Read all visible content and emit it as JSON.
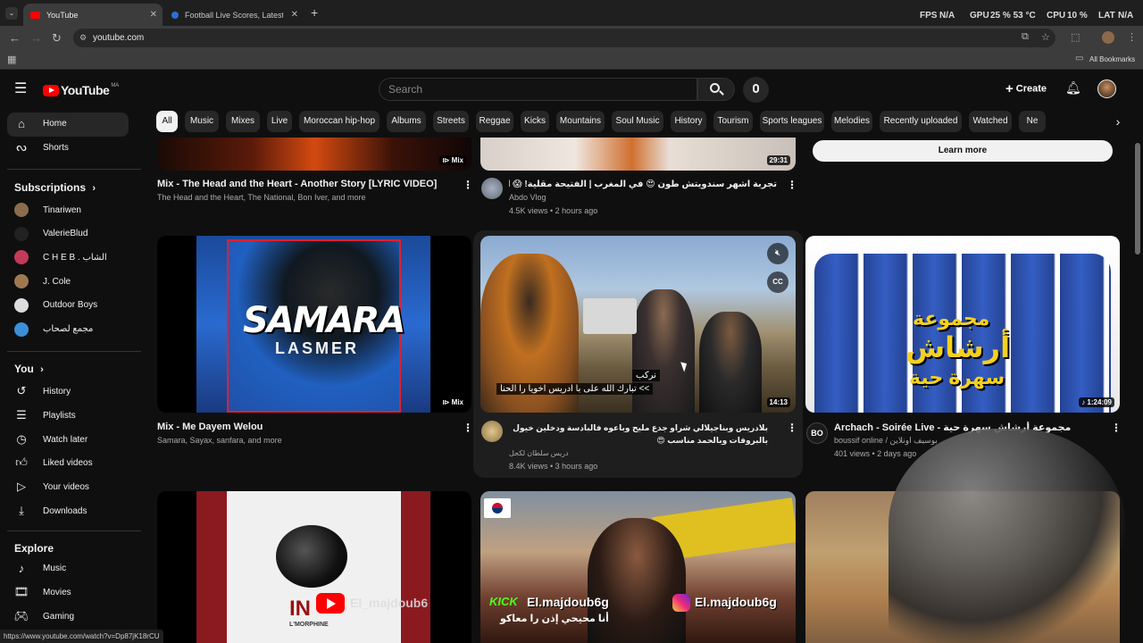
{
  "browser": {
    "tabs": [
      {
        "title": "YouTube"
      },
      {
        "title": "Football Live Scores, Latest Foo"
      }
    ],
    "new_tab": "+",
    "perf": {
      "fps_label": "FPS",
      "fps_value": "N/A",
      "gpu_label": "GPU",
      "gpu_value": "25 % 53 °C",
      "cpu_label": "CPU",
      "cpu_value": "10 %",
      "lat_label": "LAT",
      "lat_value": "N/A"
    },
    "url": "youtube.com",
    "bookmarks_label": "All Bookmarks",
    "status_url": "https://www.youtube.com/watch?v=Dp87jK18rCU"
  },
  "header": {
    "logo_text": "YouTube",
    "country": "MA",
    "search_placeholder": "Search",
    "create_label": "Create"
  },
  "chips": [
    "All",
    "Music",
    "Mixes",
    "Live",
    "Moroccan hip-hop",
    "Albums",
    "Streets",
    "Reggae",
    "Kicks",
    "Mountains",
    "Soul Music",
    "History",
    "Tourism",
    "Sports leagues",
    "Melodies",
    "Recently uploaded",
    "Watched",
    "Ne"
  ],
  "sidebar": {
    "main": [
      {
        "label": "Home"
      },
      {
        "label": "Shorts"
      }
    ],
    "subscriptions_title": "Subscriptions",
    "subscriptions": [
      {
        "label": "Tinariwen",
        "color": "#8a6d4e"
      },
      {
        "label": "ValerieBlud",
        "color": "#222222"
      },
      {
        "label": "C H E B . الشاب",
        "color": "#c33a5a"
      },
      {
        "label": "J. Cole",
        "color": "#a07850"
      },
      {
        "label": "Outdoor Boys",
        "color": "#dddddd"
      },
      {
        "label": "مجمع لصحاب",
        "color": "#3b8fd9"
      }
    ],
    "you_title": "You",
    "you": [
      {
        "label": "History"
      },
      {
        "label": "Playlists"
      },
      {
        "label": "Watch later"
      },
      {
        "label": "Liked videos"
      },
      {
        "label": "Your videos"
      },
      {
        "label": "Downloads"
      }
    ],
    "explore_title": "Explore",
    "explore": [
      {
        "label": "Music"
      },
      {
        "label": "Movies"
      },
      {
        "label": "Gaming"
      }
    ]
  },
  "videos": {
    "row1": [
      {
        "title": "Mix - The Head and the Heart - Another Story [LYRIC VIDEO]",
        "sub": "The Head and the Heart, The National, Bon Iver, and more",
        "badge": "Mix"
      },
      {
        "title": "تجربة اشهر سندويتش طون 😍 في المغرب | الفتيحة مقلية! 😱 streetfood#",
        "channel": "Abdo Vlog",
        "meta": "4.5K views • 2 hours ago",
        "duration": "29:31"
      },
      {
        "button": "Learn more"
      }
    ],
    "row2": [
      {
        "title": "Mix - Me Dayem Welou",
        "sub": "Samara, Sayax, sanfara, and more",
        "badge": "Mix",
        "art_title": "SAMARA",
        "art_sub": "LASMER"
      },
      {
        "title": "بلادريس وبناجيلالي شراو جدع مليح وباعوه فالبادسة ودخلين خيول بالبروفات وبالحمد مناسب 😍",
        "channel": "دريس سلطان لكحل",
        "meta": "8.4K views • 3 hours ago",
        "duration": "14:13",
        "caption1": "نركب",
        "caption2": ">> تبارك الله على با ادريس اخويا را الحنا"
      },
      {
        "title": "Archach - Soirée Live - مجموعة أرشاش سهرة حية",
        "channel": "boussif online / بوسيف اونلاين",
        "meta": "401 views • 2 days ago",
        "duration": "1:24:09",
        "art_top": "مجموعة",
        "art_mid": "أرشاش",
        "art_bot": "سهرة حية"
      }
    ],
    "row3": [
      {
        "art_text": "IN",
        "art_sub": "L'MORPHINE"
      },
      {
        "overlay_kick": "KICK",
        "overlay_handle": "El.majdoub6g",
        "overlay_handle_ig": "El.majdoub6g",
        "caption": "أنا محيحي إذن را معاكو"
      },
      {
        "handle": "El_majdoub6"
      }
    ]
  },
  "colors": {
    "bg": "#0f0f0f",
    "yt_red": "#ff0000",
    "chip": "#272727",
    "text_secondary": "#aaaaaa"
  }
}
